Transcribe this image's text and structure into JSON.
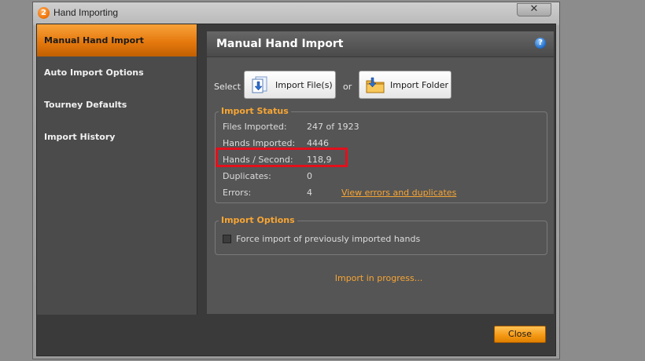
{
  "window": {
    "title": "Hand Importing",
    "app_icon": "2",
    "close_glyph": "✕"
  },
  "sidebar": {
    "items": [
      {
        "label": "Manual Hand Import",
        "active": true
      },
      {
        "label": "Auto Import Options",
        "active": false
      },
      {
        "label": "Tourney Defaults",
        "active": false
      },
      {
        "label": "Import History",
        "active": false
      }
    ]
  },
  "panel": {
    "title": "Manual Hand Import",
    "help_glyph": "?",
    "select_label": "Select",
    "or_label": "or",
    "import_files_label": "Import File(s)",
    "import_folder_label": "Import Folder",
    "icons": {
      "files": "import-file-icon",
      "folder": "import-folder-icon"
    }
  },
  "import_status": {
    "title": "Import Status",
    "rows": [
      {
        "label": "Files Imported:",
        "value": "247 of 1923"
      },
      {
        "label": "Hands Imported:",
        "value": "4446"
      },
      {
        "label": "Hands / Second:",
        "value": "118,9"
      },
      {
        "label": "Duplicates:",
        "value": "0"
      },
      {
        "label": "Errors:",
        "value": "4"
      }
    ],
    "errors_link": "View errors and duplicates"
  },
  "import_options": {
    "title": "Import Options",
    "force_import_label": "Force import of previously imported hands",
    "force_import_checked": false
  },
  "progress_text": "Import in progress...",
  "footer": {
    "close_label": "Close"
  },
  "colors": {
    "accent": "#f7a534",
    "highlight": "#e2101c"
  }
}
